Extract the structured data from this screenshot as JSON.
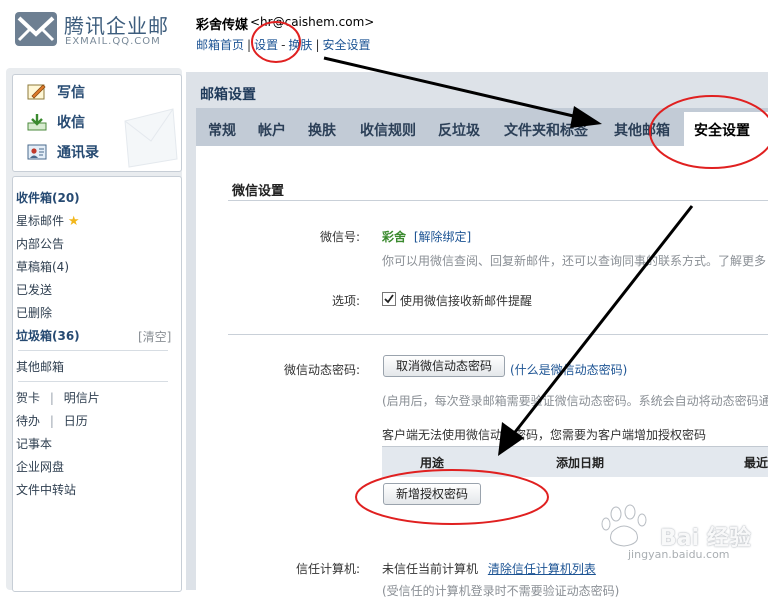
{
  "header": {
    "logo_text": "腾讯企业邮",
    "logo_sub": "EXMAIL.QQ.COM",
    "user_name": "彩舍传媒",
    "user_email": "<hr@caishem.com>",
    "nav": [
      "邮箱首页",
      "设置",
      "换肤",
      "安全设置"
    ]
  },
  "sidebar": {
    "quick": [
      {
        "label": "写信",
        "icon": "compose-icon"
      },
      {
        "label": "收信",
        "icon": "inbox-download-icon"
      },
      {
        "label": "通讯录",
        "icon": "contacts-icon"
      }
    ],
    "folders": {
      "inbox": "收件箱(20)",
      "starred": "星标邮件",
      "notice": "内部公告",
      "drafts": "草稿箱(4)",
      "sent": "已发送",
      "deleted": "已删除",
      "spam": "垃圾箱(36)",
      "spam_clear": "[清空]",
      "other": "其他邮箱",
      "card": "贺卡",
      "postcard": "明信片",
      "todo": "待办",
      "calendar": "日历",
      "notes": "记事本",
      "disk": "企业网盘",
      "transfer": "文件中转站"
    }
  },
  "main": {
    "title": "邮箱设置",
    "tabs": [
      "常规",
      "帐户",
      "换肤",
      "收信规则",
      "反垃圾",
      "文件夹和标签",
      "其他邮箱",
      "安全设置"
    ],
    "active_tab": "安全设置",
    "section_title": "微信设置",
    "wechat": {
      "label": "微信号:",
      "account": "彩舍",
      "unbind": "[解除绑定]",
      "desc": "你可以用微信查阅、回复新邮件，还可以查询同事的联系方式。了解更多"
    },
    "options": {
      "label": "选项:",
      "checkbox_label": "使用微信接收新邮件提醒",
      "checked": true
    },
    "dynamic_pwd": {
      "label": "微信动态密码:",
      "cancel_button": "取消微信动态密码",
      "what_link": "(什么是微信动态密码)",
      "desc": "(启用后，每次登录邮箱需要验证微信动态密码。系统会自动将动态密码通",
      "client_note": "客户端无法使用微信动态密码，您需要为客户端增加授权密码",
      "table_headers": [
        "用途",
        "添加日期",
        "最近"
      ],
      "add_button": "新增授权密码"
    },
    "trust": {
      "label": "信任计算机:",
      "status": "未信任当前计算机",
      "clear_link": "清除信任计算机列表",
      "desc": "(受信任的计算机登录时不需要验证动态密码)"
    }
  },
  "watermark": {
    "text": "Bai 经验",
    "url": "jingyan.baidu.com"
  }
}
